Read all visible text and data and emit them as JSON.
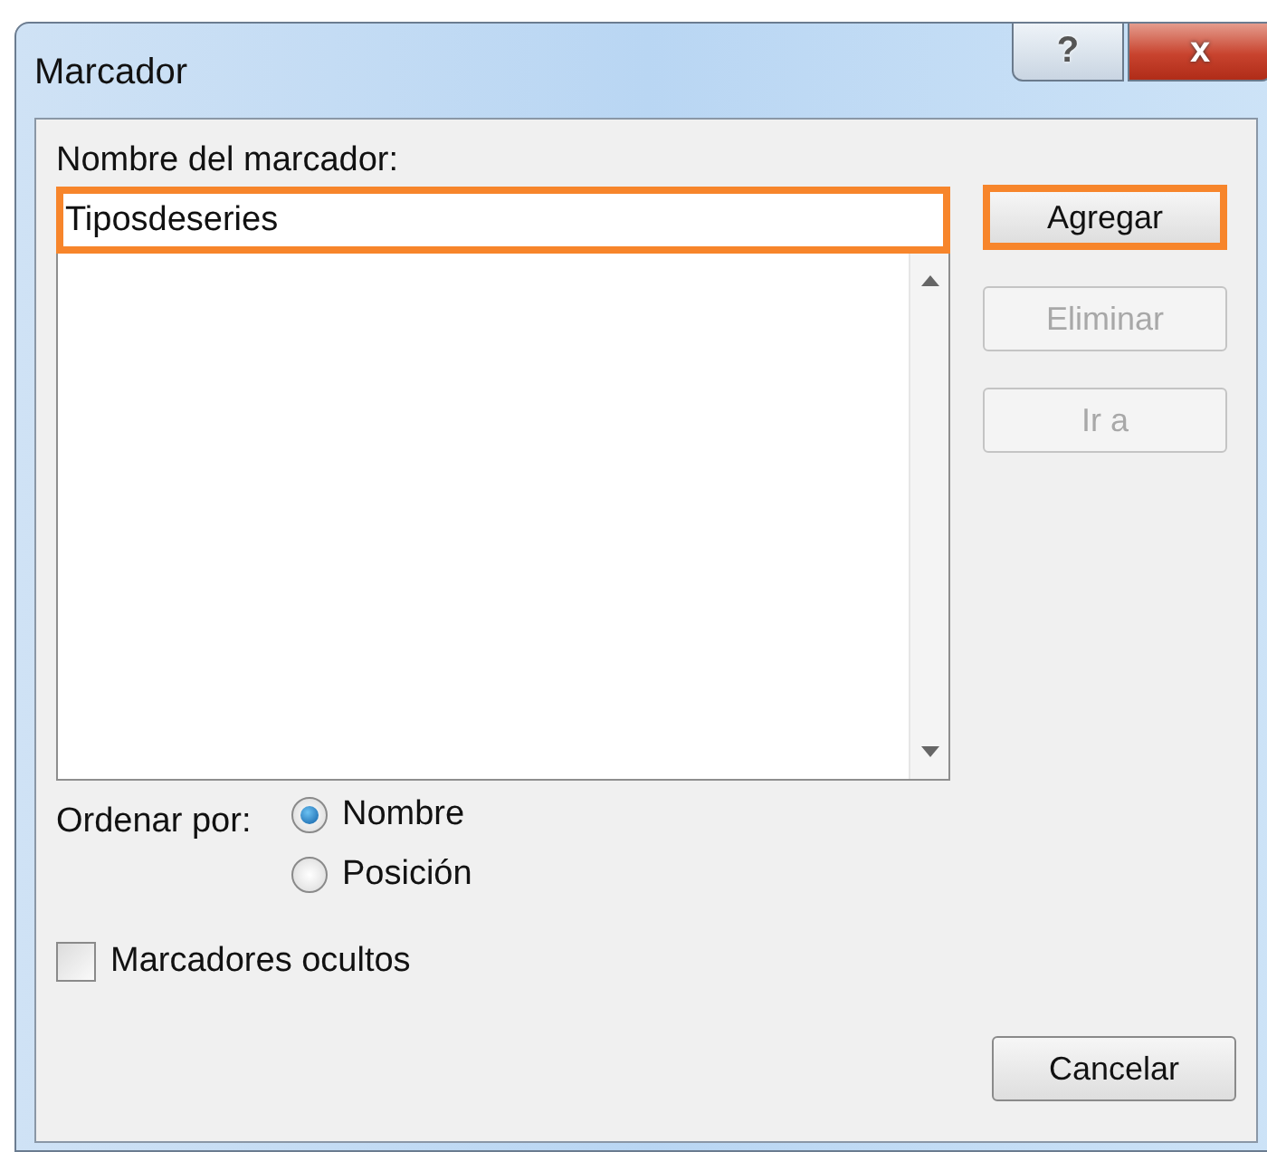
{
  "window": {
    "title": "Marcador",
    "help_button": "?",
    "close_button": "x"
  },
  "name_field": {
    "label": "Nombre del marcador:",
    "value": "Tiposdeseries",
    "highlighted": true
  },
  "buttons": [
    {
      "label": "Agregar",
      "disabled": false,
      "highlighted": true
    },
    {
      "label": "Eliminar",
      "disabled": true,
      "highlighted": false
    },
    {
      "label": "Ir a",
      "disabled": true,
      "highlighted": false
    }
  ],
  "sort": {
    "label": "Ordenar por:",
    "options": [
      {
        "label": "Nombre",
        "selected": true
      },
      {
        "label": "Posición",
        "selected": false
      }
    ]
  },
  "hidden_bookmarks": {
    "label": "Marcadores ocultos",
    "checked": false
  },
  "cancel_button": {
    "label": "Cancelar"
  }
}
